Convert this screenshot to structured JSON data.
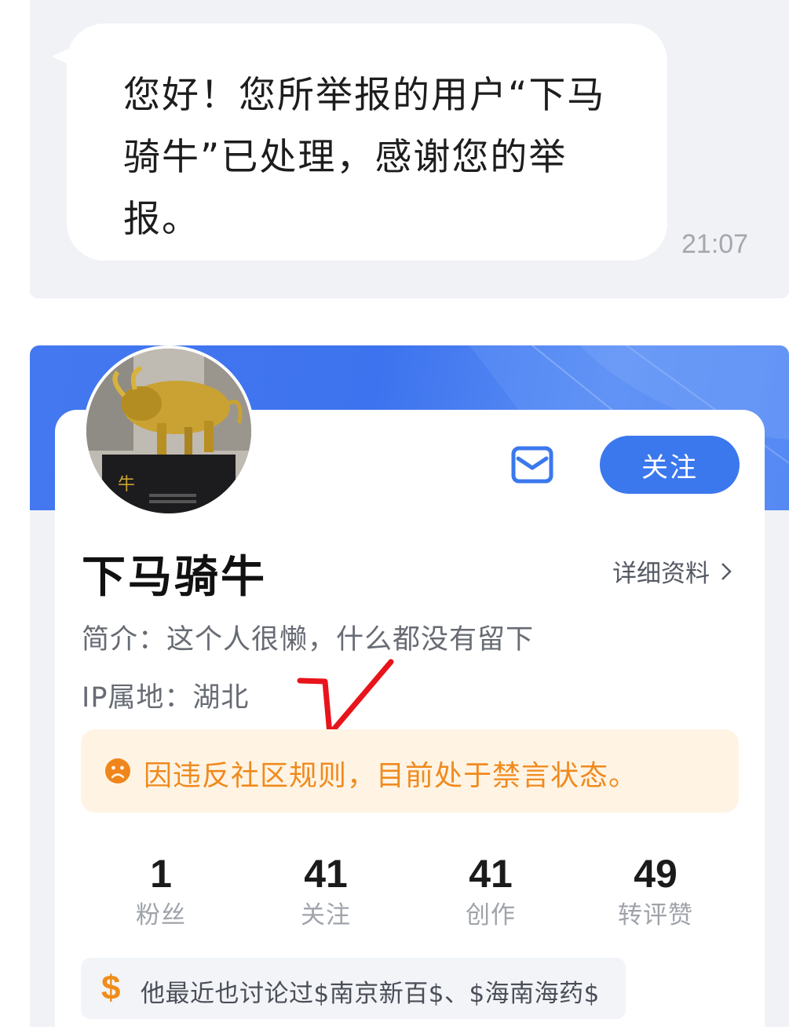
{
  "chat": {
    "message_lines": [
      "您好！您所举报的用户“下马",
      "骑牛”已处理，感谢您的举",
      "报。"
    ],
    "time": "21:07"
  },
  "profile": {
    "username": "下马骑牛",
    "follow_label": "关注",
    "detail_link": "详细资料",
    "intro": "简介：这个人很懒，什么都没有留下",
    "ip_location": "IP属地：湖北",
    "ban_notice": "因违反社区规则，目前处于禁言状态。",
    "stats": [
      {
        "value": "1",
        "label": "粉丝"
      },
      {
        "value": "41",
        "label": "关注"
      },
      {
        "value": "41",
        "label": "创作"
      },
      {
        "value": "49",
        "label": "转评赞"
      }
    ],
    "discussion": "他最近也讨论过$南京新百$、$海南海药$"
  },
  "colors": {
    "accent": "#3b78ee",
    "warning": "#f08a1e",
    "annotation": "#e8141b"
  }
}
